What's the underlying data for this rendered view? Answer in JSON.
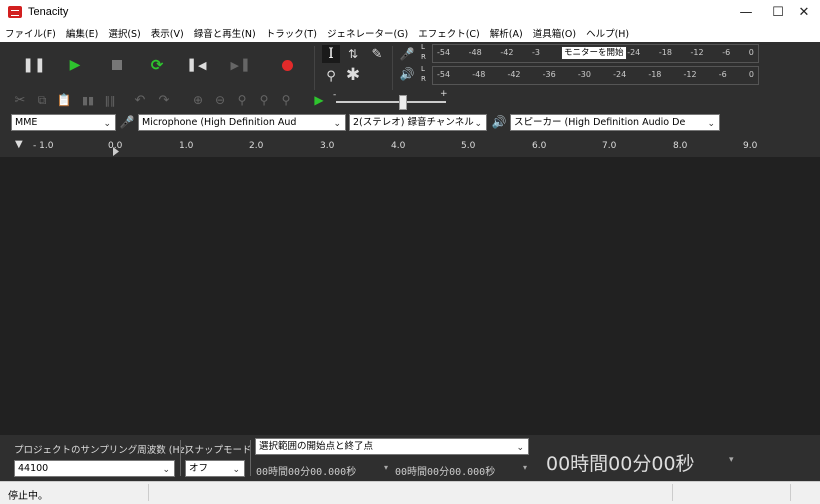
{
  "window": {
    "title": "Tenacity"
  },
  "menu": [
    "ファイル(F)",
    "編集(E)",
    "選択(S)",
    "表示(V)",
    "録音と再生(N)",
    "トラック(T)",
    "ジェネレーター(G)",
    "エフェクト(C)",
    "解析(A)",
    "道具箱(O)",
    "ヘルプ(H)"
  ],
  "meter": {
    "lr_top": "L",
    "lr_bottom": "R",
    "record_scale": [
      "-54",
      "-48",
      "-42",
      "-3",
      "",
      "-24",
      "-18",
      "-12",
      "-6",
      "0"
    ],
    "record_tooltip": "モニターを開始",
    "play_scale": [
      "-54",
      "-48",
      "-42",
      "-36",
      "-30",
      "-24",
      "-18",
      "-12",
      "-6",
      "0"
    ]
  },
  "slider": {
    "minus": "-",
    "plus": "+",
    "level": 0.6
  },
  "devices": {
    "host": "MME",
    "input": "Microphone (High Definition Aud",
    "channels": "2(ステレオ) 録音チャンネル",
    "output": "スピーカー (High Definition Audio De"
  },
  "ruler": [
    "- 1.0",
    "0.0",
    "1.0",
    "2.0",
    "3.0",
    "4.0",
    "5.0",
    "6.0",
    "7.0",
    "8.0",
    "9.0"
  ],
  "bottom": {
    "rate_label": "プロジェクトのサンプリング周波数 (Hz)",
    "rate_value": "44100",
    "snap_label": "スナップモード",
    "snap_value": "オフ",
    "selection_mode": "選択範囲の開始点と終了点",
    "start_time": "00時間00分00.000秒",
    "end_time": "00時間00分00.000秒",
    "big_time": "00時間00分00秒"
  },
  "status": {
    "text": "停止中。"
  }
}
